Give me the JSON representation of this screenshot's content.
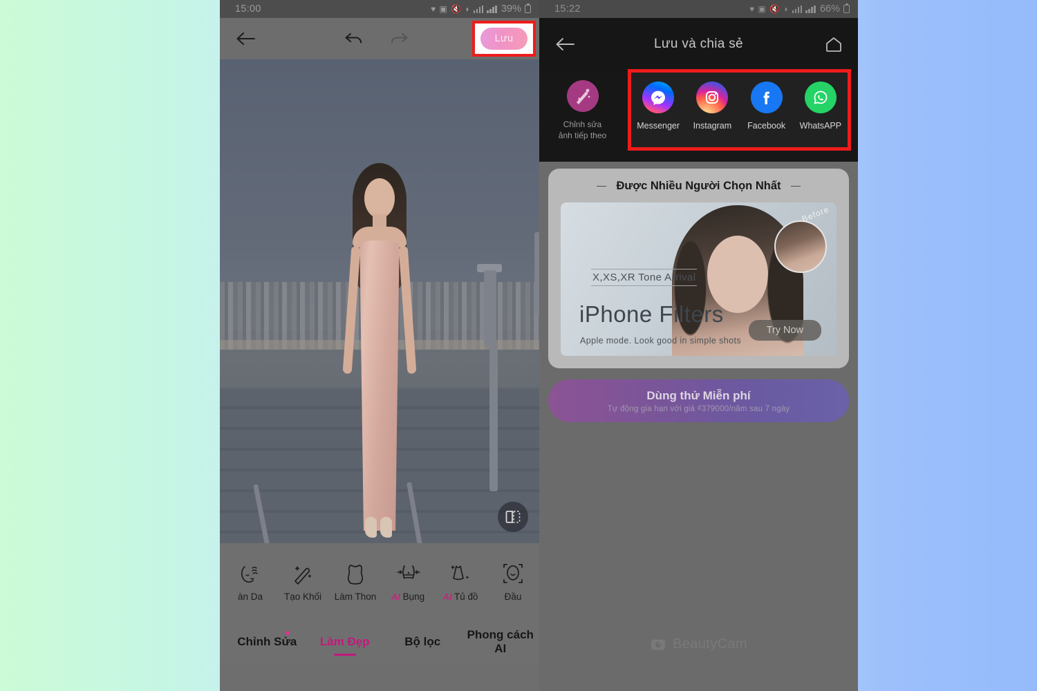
{
  "background": {
    "left_color": "#ccfbd7",
    "right_color": "#95bbfb"
  },
  "highlight_color": "#ee1c1c",
  "accent_color": "#c3197b",
  "left_phone": {
    "status_bar": {
      "time": "15:00",
      "battery_percent": "39%",
      "icons": [
        "heart-icon",
        "camera-icon",
        "mute-icon",
        "wifi-icon",
        "signal-icon",
        "signal-icon",
        "battery-icon"
      ]
    },
    "toolbar": {
      "back_label": "back-arrow-icon",
      "undo_label": "undo-icon",
      "redo_label": "redo-icon",
      "save_label": "Lưu"
    },
    "photo": {
      "compare_label": "compare-icon"
    },
    "tools": [
      {
        "label": "àn Da",
        "icon": "skin-icon"
      },
      {
        "label": "Tạo Khối",
        "icon": "contour-wand-icon"
      },
      {
        "label": "Làm Thon",
        "icon": "slim-body-icon"
      },
      {
        "label": "Bụng",
        "ai": "AI",
        "icon": "belly-icon"
      },
      {
        "label": "Tủ đồ",
        "ai": "AI",
        "icon": "dress-icon"
      },
      {
        "label": "Đầu",
        "icon": "head-icon"
      }
    ],
    "tabs": [
      {
        "label": "Chỉnh Sửa",
        "active": false,
        "badge": true
      },
      {
        "label": "Làm Đẹp",
        "active": true,
        "badge": false
      },
      {
        "label": "Bộ lọc",
        "active": false,
        "badge": false
      },
      {
        "label": "Phong cách AI",
        "active": false,
        "badge": false
      }
    ]
  },
  "right_phone": {
    "status_bar": {
      "time": "15:22",
      "battery_percent": "66%",
      "icons": [
        "heart-icon",
        "camera-icon",
        "mute-icon",
        "wifi-icon",
        "signal-icon",
        "signal-icon",
        "battery-icon"
      ]
    },
    "header": {
      "title": "Lưu và chia sẻ",
      "back_label": "back-arrow-icon",
      "home_label": "home-icon"
    },
    "next_photo": {
      "label": "Chỉnh sửa\nảnh tiếp theo",
      "line1": "Chỉnh sửa",
      "line2": "ảnh tiếp theo",
      "icon": "magic-wand-icon"
    },
    "share_targets": [
      {
        "label": "Messenger",
        "icon": "messenger-icon"
      },
      {
        "label": "Instagram",
        "icon": "instagram-icon"
      },
      {
        "label": "Facebook",
        "icon": "facebook-icon"
      },
      {
        "label": "WhatsAPP",
        "icon": "whatsapp-icon"
      }
    ],
    "promo": {
      "section_title": "Được Nhiều Người Chọn Nhất",
      "banner": {
        "eyebrow": "X,XS,XR Tone Arrival",
        "title": "iPhone Filters",
        "description": "Apple mode. Look good in simple shots",
        "before_label": "Before",
        "cta": "Try Now"
      },
      "trial": {
        "main": "Dùng thử Miễn phí",
        "sub": "Tự động gia hạn với giá ₫379000/năm sau 7 ngày"
      }
    },
    "watermark": {
      "text": "BeautyCam",
      "icon": "camera-icon"
    }
  }
}
